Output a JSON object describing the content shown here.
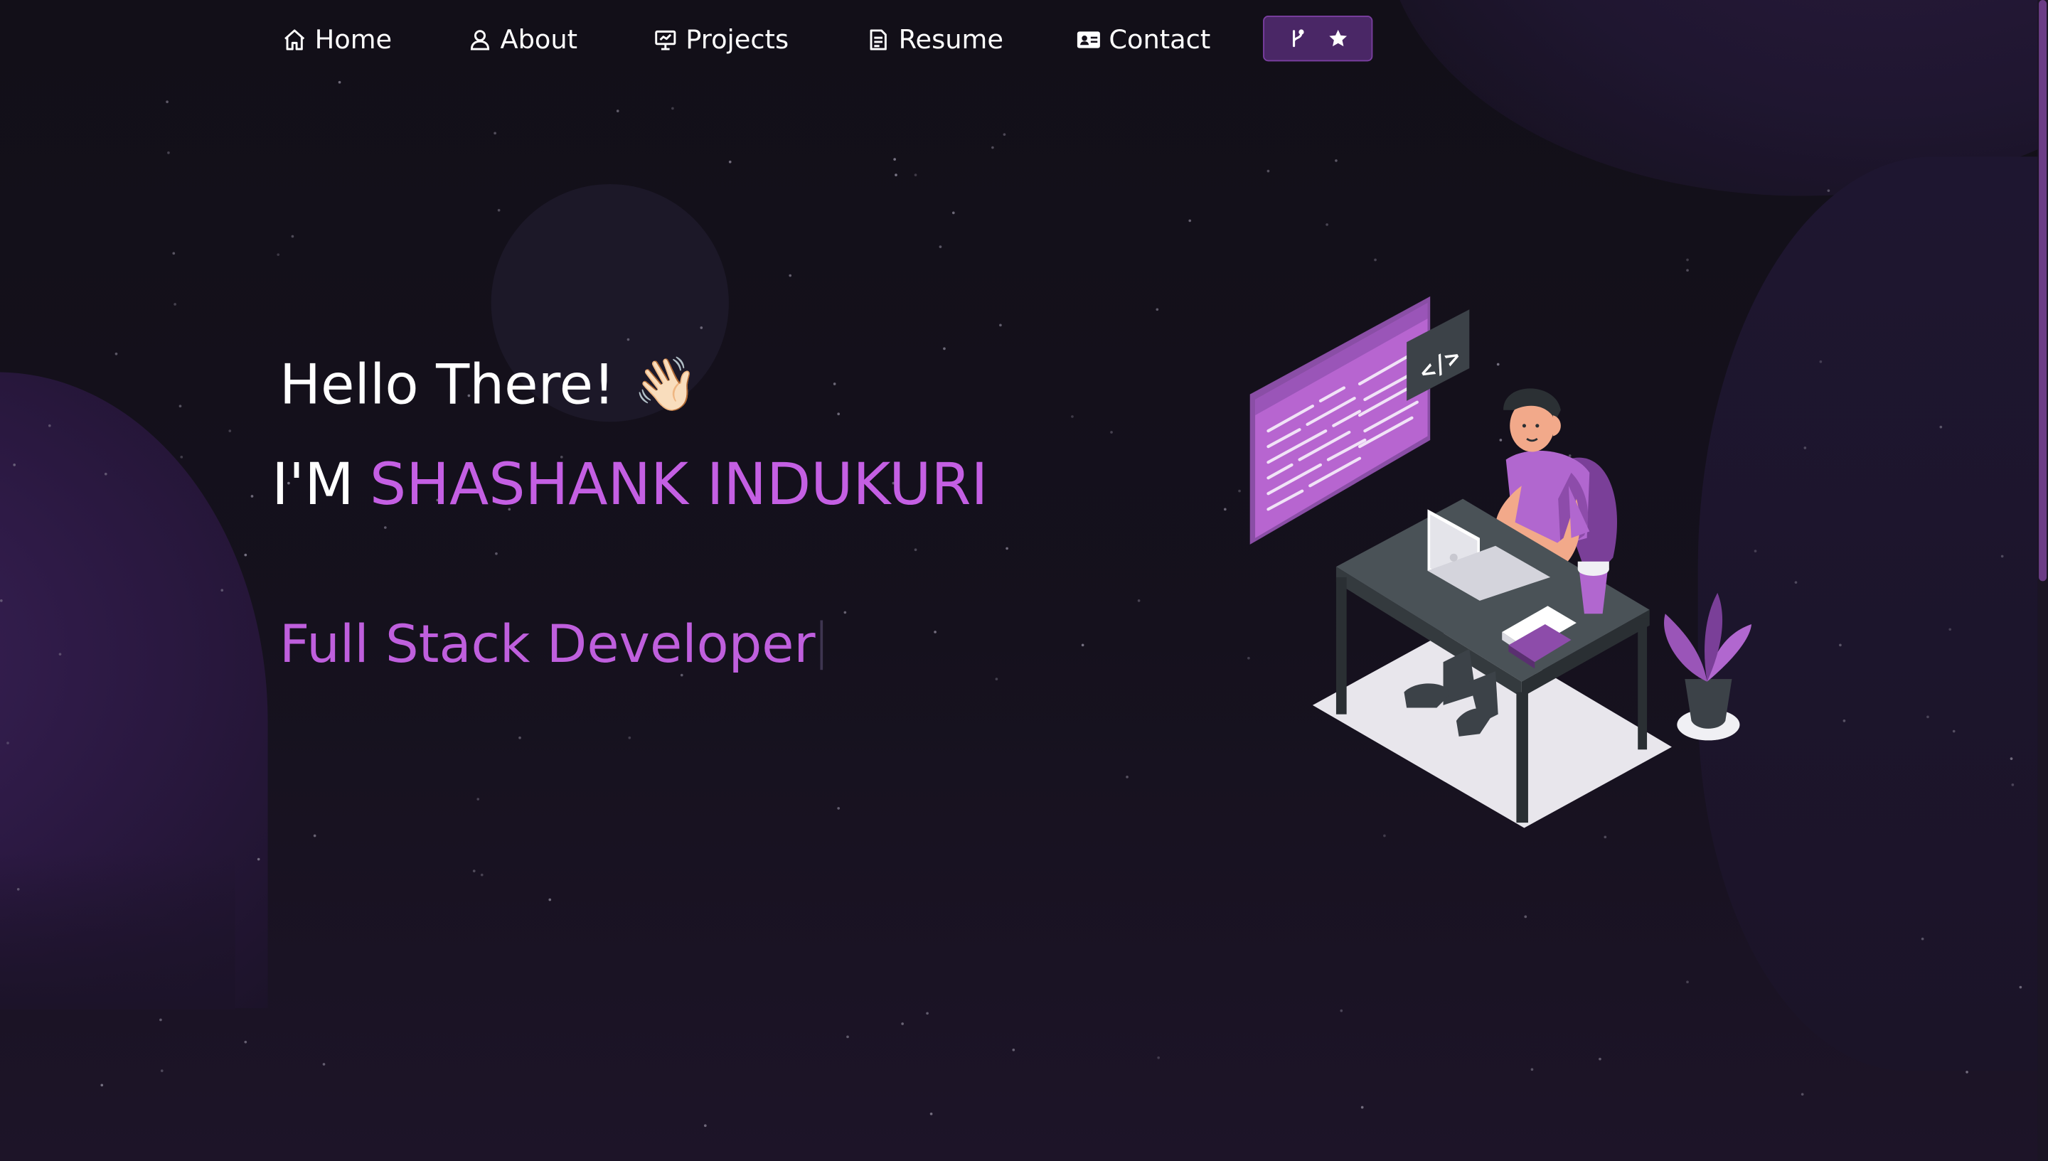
{
  "nav": {
    "items": [
      {
        "label": "Home",
        "icon": "home-icon"
      },
      {
        "label": "About",
        "icon": "user-icon"
      },
      {
        "label": "Projects",
        "icon": "presentation-icon"
      },
      {
        "label": "Resume",
        "icon": "document-icon"
      },
      {
        "label": "Contact",
        "icon": "contact-card-icon"
      }
    ],
    "github_button": {
      "icons": [
        "git-fork-icon",
        "star-icon"
      ]
    }
  },
  "hero": {
    "greeting": "Hello There!",
    "wave_emoji": "👋🏻",
    "intro_prefix": "I'M",
    "name": "SHASHANK INDUKURI",
    "typed_role": "Full Stack Developer"
  },
  "illustration": {
    "code_tag": "</>"
  },
  "colors": {
    "accent": "#c45fe3",
    "role": "#bf5fdd",
    "button_bg": "#4a2766",
    "background": "#130f19"
  }
}
